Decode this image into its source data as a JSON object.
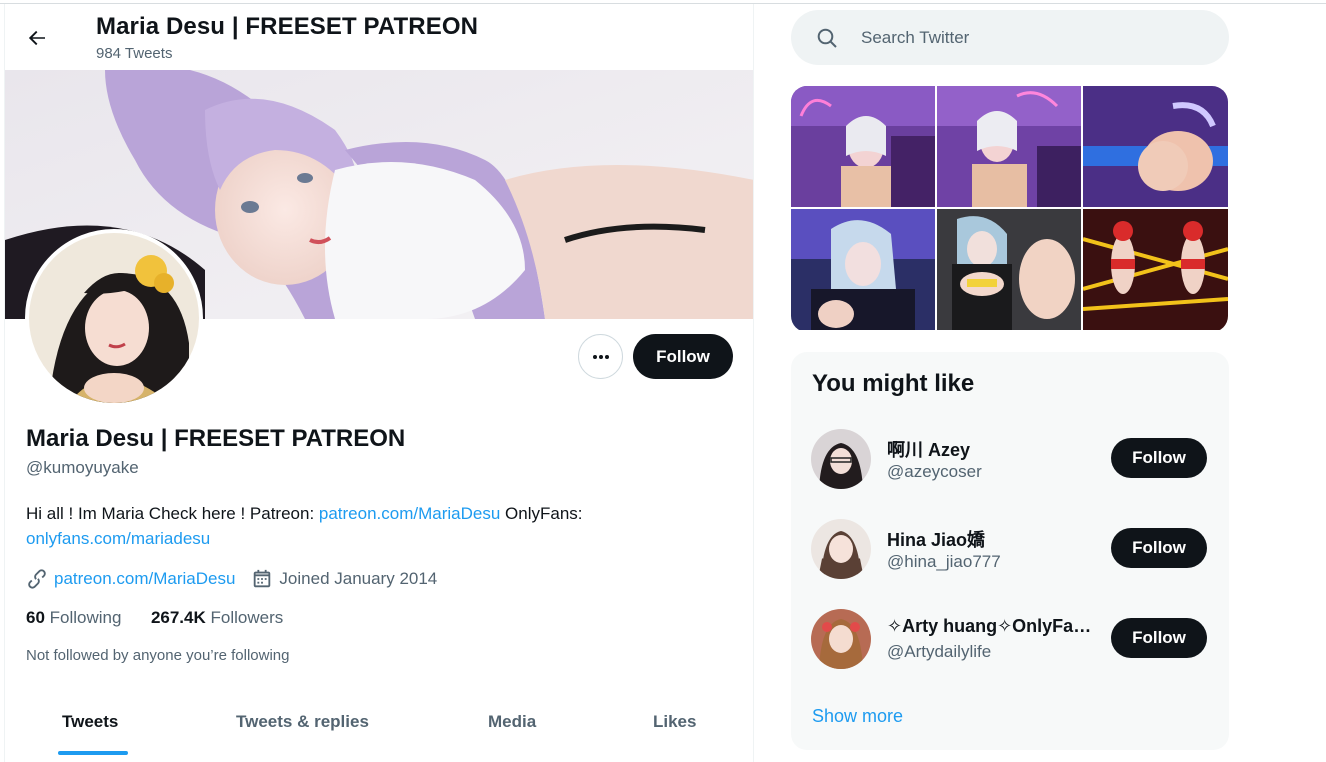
{
  "header": {
    "title": "Maria Desu | FREESET PATREON",
    "tweet_count": "984 Tweets"
  },
  "profile": {
    "name": "Maria Desu | FREESET PATREON",
    "handle": "@kumoyuyake",
    "follow_label": "Follow",
    "bio": {
      "text_1": "Hi all ! Im Maria Check here ! Patreon: ",
      "link_1": "patreon.com/MariaDesu",
      "text_2": " OnlyFans: ",
      "link_2": "onlyfans.com/mariadesu"
    },
    "website": "patreon.com/MariaDesu",
    "joined": "Joined January 2014",
    "following_count": "60",
    "following_label": "Following",
    "followers_count": "267.4K",
    "followers_label": "Followers",
    "not_followed": "Not followed by anyone you’re following"
  },
  "tabs": [
    {
      "label": "Tweets",
      "active": true
    },
    {
      "label": "Tweets & replies",
      "active": false
    },
    {
      "label": "Media",
      "active": false
    },
    {
      "label": "Likes",
      "active": false
    }
  ],
  "search": {
    "placeholder": "Search Twitter"
  },
  "who_to_follow": {
    "title": "You might like",
    "users": [
      {
        "name": "啊川 Azey",
        "handle": "@azeycoser",
        "follow_label": "Follow"
      },
      {
        "name": "Hina Jiao嬌",
        "handle": "@hina_jiao777",
        "follow_label": "Follow"
      },
      {
        "name": "✧Arty huang✧OnlyFans✧",
        "handle": "@Artydailylife",
        "follow_label": "Follow"
      }
    ],
    "show_more": "Show more"
  },
  "colors": {
    "accent": "#1d9bf0",
    "text_primary": "#0f1419",
    "text_secondary": "#536471",
    "button_dark": "#0f1419"
  },
  "icons": [
    "back-arrow-icon",
    "more-dots-icon",
    "link-icon",
    "calendar-icon",
    "search-icon"
  ]
}
